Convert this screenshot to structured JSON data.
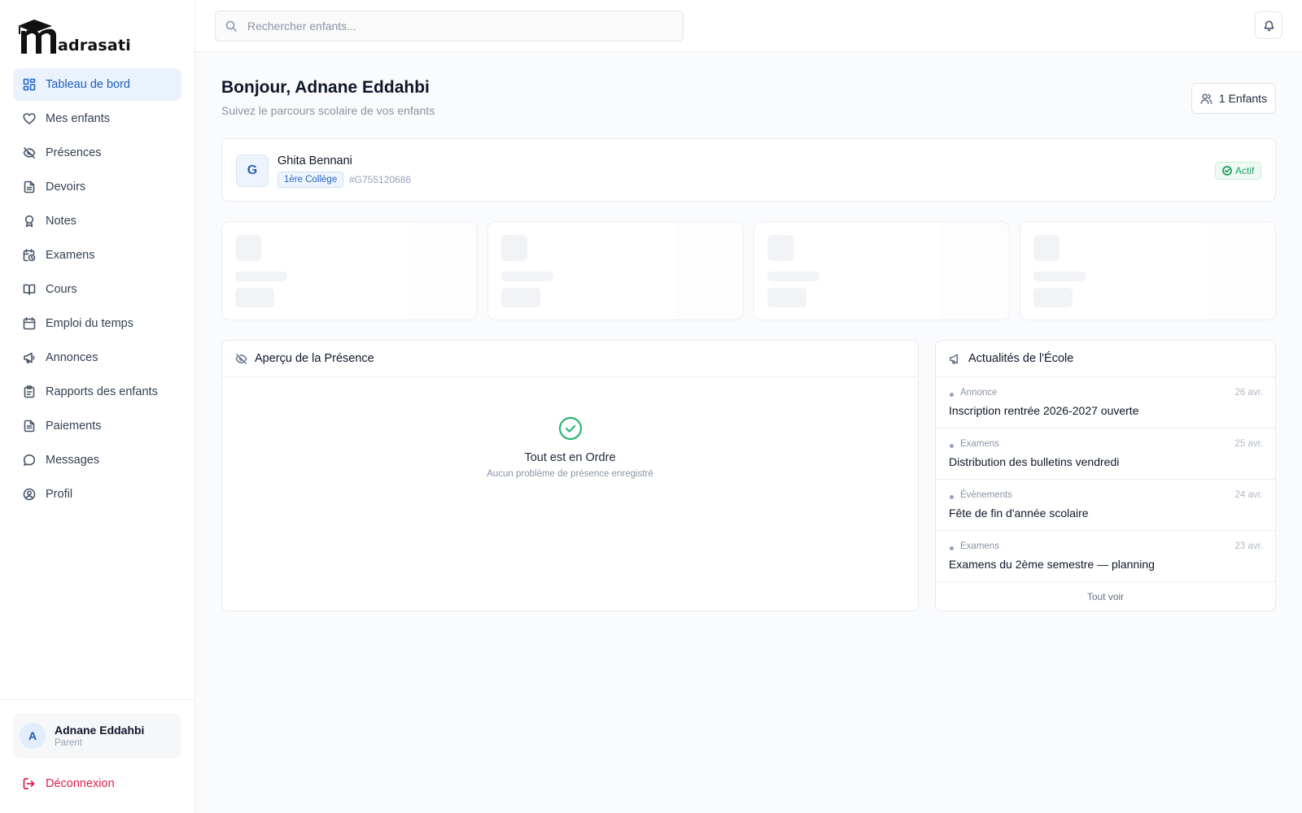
{
  "app": {
    "logo_text": "adrasati"
  },
  "sidebar": {
    "items": [
      {
        "label": "Tableau de bord",
        "icon": "dashboard-icon",
        "active": true
      },
      {
        "label": "Mes enfants",
        "icon": "heart-icon"
      },
      {
        "label": "Présences",
        "icon": "eye-off-icon"
      },
      {
        "label": "Devoirs",
        "icon": "file-icon"
      },
      {
        "label": "Notes",
        "icon": "award-icon"
      },
      {
        "label": "Examens",
        "icon": "calendar-clock-icon"
      },
      {
        "label": "Cours",
        "icon": "book-icon"
      },
      {
        "label": "Emploi du temps",
        "icon": "calendar-icon"
      },
      {
        "label": "Annonces",
        "icon": "megaphone-icon"
      },
      {
        "label": "Rapports des enfants",
        "icon": "clipboard-icon"
      },
      {
        "label": "Paiements",
        "icon": "receipt-icon"
      },
      {
        "label": "Messages",
        "icon": "message-icon"
      },
      {
        "label": "Profil",
        "icon": "user-circle-icon"
      }
    ],
    "user": {
      "initial": "A",
      "name": "Adnane Eddahbi",
      "role": "Parent"
    },
    "logout_label": "Déconnexion"
  },
  "topbar": {
    "search_placeholder": "Rechercher enfants..."
  },
  "main": {
    "greeting": "Bonjour, Adnane Eddahbi",
    "subtitle": "Suivez le parcours scolaire de vos enfants",
    "children_button": "1 Enfants",
    "child": {
      "initial": "G",
      "name": "Ghita Bennani",
      "grade": "1ère Collège",
      "id": "#G755120686",
      "status": "Actif"
    },
    "attendance": {
      "title": "Aperçu de la Présence",
      "ok_title": "Tout est en Ordre",
      "ok_subtitle": "Aucun problème de présence enregistré"
    },
    "news": {
      "title": "Actualités de l'École",
      "items": [
        {
          "category": "Annonce",
          "date": "26 avr.",
          "title": "Inscription rentrée 2026-2027 ouverte"
        },
        {
          "category": "Examens",
          "date": "25 avr.",
          "title": "Distribution des bulletins vendredi"
        },
        {
          "category": "Évènements",
          "date": "24 avr.",
          "title": "Fête de fin d'année scolaire"
        },
        {
          "category": "Examens",
          "date": "23 avr.",
          "title": "Examens du 2ème semestre — planning"
        }
      ],
      "see_all": "Tout voir"
    }
  },
  "colors": {
    "accent": "#2563c9",
    "active_bg": "#eaf2fd",
    "success": "#1f9d63",
    "danger": "#e11d48"
  }
}
